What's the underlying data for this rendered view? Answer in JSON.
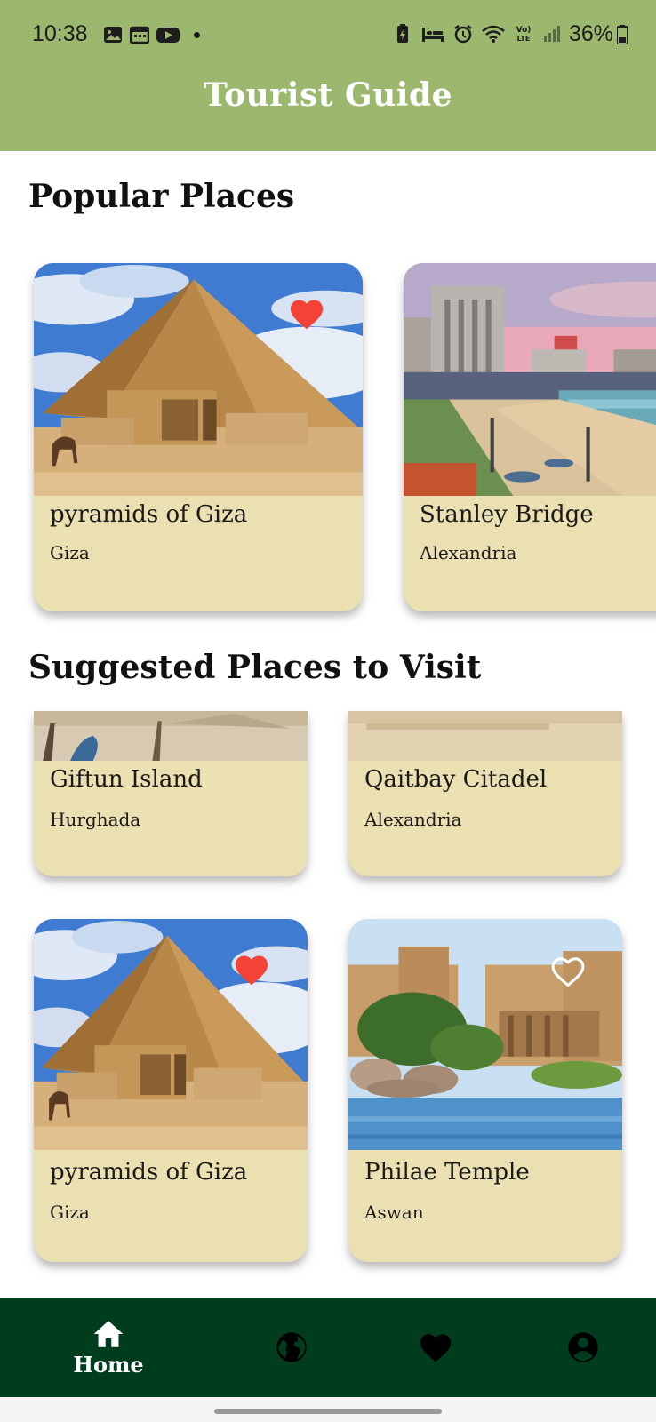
{
  "status_bar": {
    "time": "10:38",
    "battery": "36%",
    "icons_left": [
      "image-icon",
      "calendar-icon",
      "youtube-icon",
      "dot"
    ],
    "icons_right": [
      "battery-saver-icon",
      "bed-icon",
      "alarm-icon",
      "wifi-icon",
      "volte-icon",
      "signal-icon"
    ]
  },
  "app_bar": {
    "title": "Tourist Guide"
  },
  "popular": {
    "heading": "Popular Places",
    "items": [
      {
        "name": "pyramids of Giza",
        "city": "Giza",
        "favorite": true,
        "image": "pyramid"
      },
      {
        "name": "Stanley Bridge",
        "city": "Alexandria",
        "favorite": false,
        "image": "city-beach"
      }
    ]
  },
  "suggested": {
    "heading": "Suggested Places to Visit",
    "items": [
      {
        "name": "Giftun Island",
        "city": "Hurghada",
        "image": "beach-umbrellas"
      },
      {
        "name": "Qaitbay Citadel",
        "city": "Alexandria",
        "image": "citadel"
      },
      {
        "name": "pyramids of Giza",
        "city": "Giza",
        "favorite": true,
        "image": "pyramid"
      },
      {
        "name": "Philae Temple",
        "city": "Aswan",
        "favorite": false,
        "image": "temple"
      }
    ]
  },
  "bottom_nav": {
    "items": [
      {
        "label": "Home",
        "icon": "home-icon",
        "active": true
      },
      {
        "label": "",
        "icon": "globe-icon",
        "active": false
      },
      {
        "label": "",
        "icon": "heart-icon",
        "active": false
      },
      {
        "label": "",
        "icon": "account-icon",
        "active": false
      }
    ]
  },
  "colors": {
    "app_bar": "#9cb86f",
    "card_bg": "#ebe0b2",
    "bottom_nav": "#003d1f",
    "favorite_heart": "#f44336"
  }
}
